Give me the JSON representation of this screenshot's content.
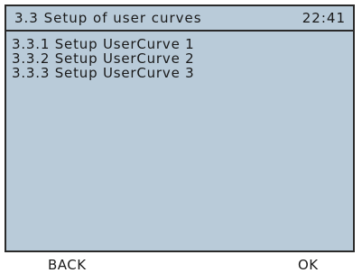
{
  "header": {
    "title": "3.3  Setup of user curves",
    "time": "22:41"
  },
  "menu": {
    "items": [
      {
        "label": "3.3.1 Setup UserCurve 1"
      },
      {
        "label": "3.3.2 Setup UserCurve 2"
      },
      {
        "label": "3.3.3 Setup UserCurve 3"
      }
    ]
  },
  "softkeys": {
    "back_label": "BACK",
    "ok_label": "OK"
  },
  "colors": {
    "screen_background": "#b9cbd9",
    "border": "#2a2a2a"
  }
}
